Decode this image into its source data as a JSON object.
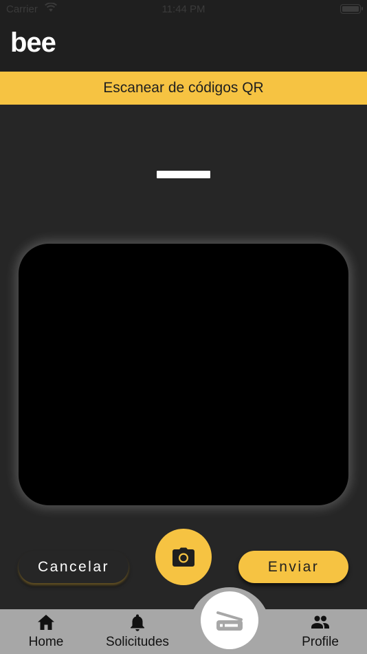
{
  "status_bar": {
    "carrier": "Carrier",
    "time": "11:44 PM"
  },
  "header": {
    "logo": "bee"
  },
  "banner": {
    "title": "Escanear de códigos QR"
  },
  "actions": {
    "cancel_label": "Cancelar",
    "send_label": "Enviar",
    "capture_icon": "camera-icon"
  },
  "bottom_nav": {
    "items": [
      {
        "label": "Home",
        "icon": "home-icon"
      },
      {
        "label": "Solicitudes",
        "icon": "bell-icon"
      },
      {
        "label": "Profile",
        "icon": "people-icon"
      }
    ],
    "center_icon": "scanner-icon"
  },
  "colors": {
    "accent": "#f6c342",
    "background": "#262626",
    "header": "#1f1f1f",
    "nav": "#a7a7a7"
  }
}
